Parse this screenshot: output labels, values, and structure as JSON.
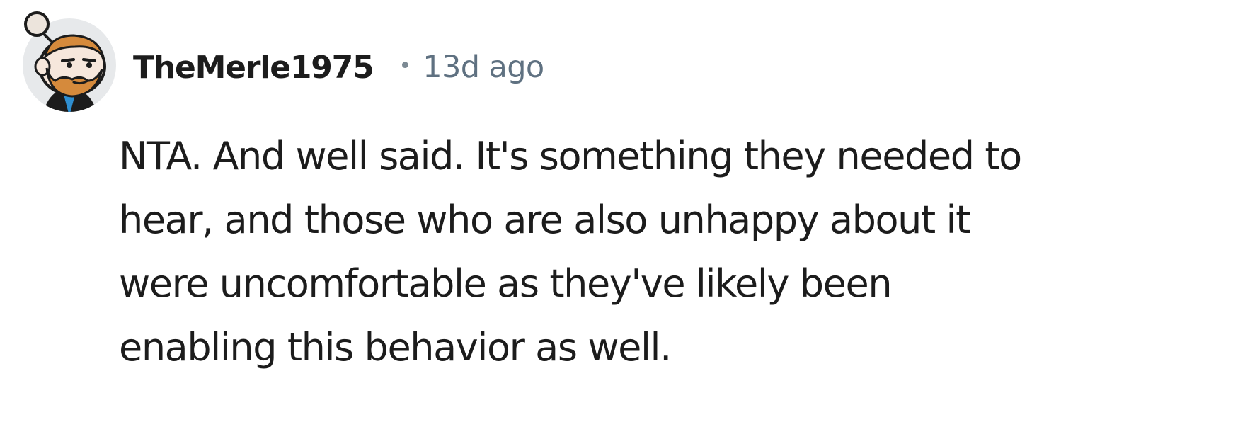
{
  "comment": {
    "avatar_icon": "reddit-snoo-avatar-icon",
    "username": "TheMerle1975",
    "separator": "•",
    "timestamp": "13d ago",
    "body_lines": [
      "NTA. And well said. It's something they needed to",
      "hear, and those who are also unhappy about it",
      "were uncomfortable as they've likely been",
      "enabling this behavior as well."
    ]
  },
  "colors": {
    "text": "#1c1c1c",
    "meta": "#5f7181",
    "avatar_background": "#e7e9eb"
  }
}
